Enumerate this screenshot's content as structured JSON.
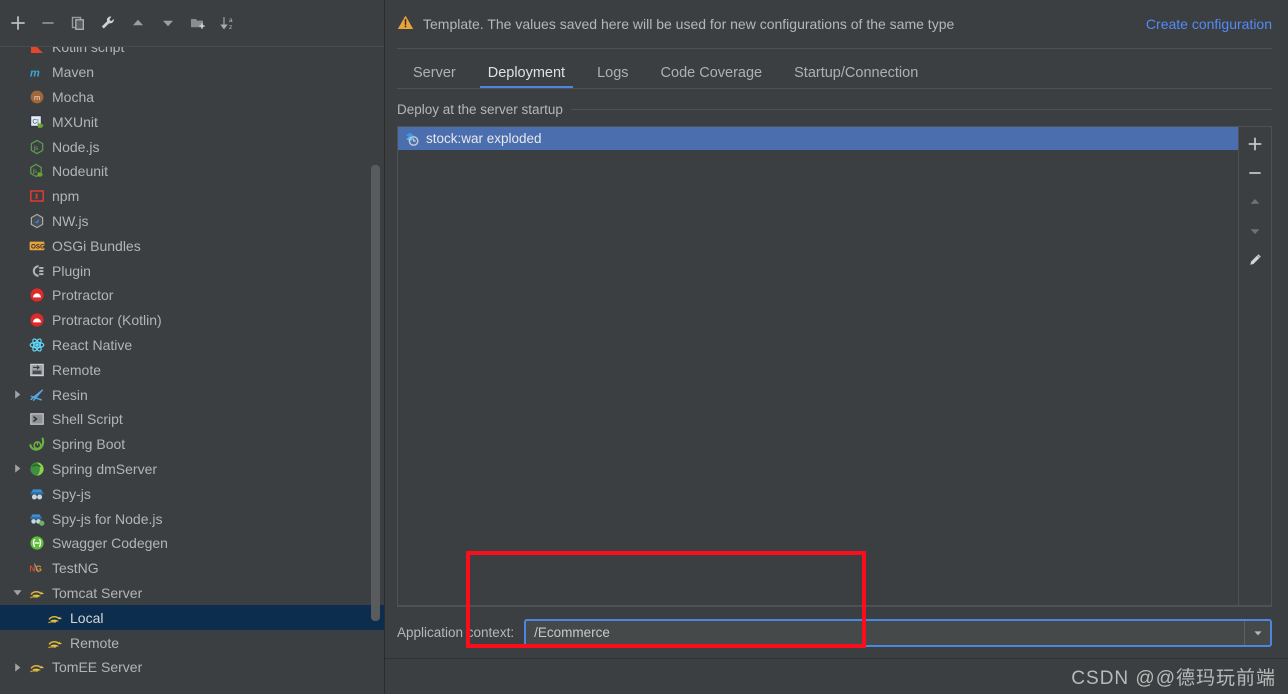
{
  "window": {
    "watermark": "CSDN @@德玛玩前端"
  },
  "toolbar": {
    "buttons": [
      {
        "name": "add",
        "icon": "plus-icon",
        "label": "Add New Configuration"
      },
      {
        "name": "remove",
        "icon": "minus-icon",
        "label": "Remove Configuration"
      },
      {
        "name": "copy",
        "icon": "copy-icon",
        "label": "Copy Configuration"
      },
      {
        "name": "edit-templates",
        "icon": "wrench-icon",
        "label": "Edit Templates"
      },
      {
        "name": "move-up",
        "icon": "arrow-up-icon",
        "label": "Move Up"
      },
      {
        "name": "move-down",
        "icon": "arrow-down-icon",
        "label": "Move Down"
      },
      {
        "name": "new-folder",
        "icon": "folder-add-icon",
        "label": "Create New Folder"
      },
      {
        "name": "sort",
        "icon": "sort-alpha-icon",
        "label": "Sort Configurations"
      }
    ]
  },
  "sidebar": {
    "items": [
      {
        "label": "Kotlin script",
        "icon": "kotlin-icon",
        "indent": 1,
        "twisty": "none",
        "selected": false
      },
      {
        "label": "Maven",
        "icon": "maven-icon",
        "indent": 1,
        "twisty": "none",
        "selected": false
      },
      {
        "label": "Mocha",
        "icon": "mocha-icon",
        "indent": 1,
        "twisty": "none",
        "selected": false
      },
      {
        "label": "MXUnit",
        "icon": "mxunit-icon",
        "indent": 1,
        "twisty": "none",
        "selected": false
      },
      {
        "label": "Node.js",
        "icon": "nodejs-icon",
        "indent": 1,
        "twisty": "none",
        "selected": false
      },
      {
        "label": "Nodeunit",
        "icon": "nodeunit-icon",
        "indent": 1,
        "twisty": "none",
        "selected": false
      },
      {
        "label": "npm",
        "icon": "npm-icon",
        "indent": 1,
        "twisty": "none",
        "selected": false
      },
      {
        "label": "NW.js",
        "icon": "nwjs-icon",
        "indent": 1,
        "twisty": "none",
        "selected": false
      },
      {
        "label": "OSGi Bundles",
        "icon": "osgi-icon",
        "indent": 1,
        "twisty": "none",
        "selected": false
      },
      {
        "label": "Plugin",
        "icon": "plugin-icon",
        "indent": 1,
        "twisty": "none",
        "selected": false
      },
      {
        "label": "Protractor",
        "icon": "protractor-icon",
        "indent": 1,
        "twisty": "none",
        "selected": false
      },
      {
        "label": "Protractor (Kotlin)",
        "icon": "protractor-icon",
        "indent": 1,
        "twisty": "none",
        "selected": false
      },
      {
        "label": "React Native",
        "icon": "react-native-icon",
        "indent": 1,
        "twisty": "none",
        "selected": false
      },
      {
        "label": "Remote",
        "icon": "remote-icon",
        "indent": 1,
        "twisty": "none",
        "selected": false
      },
      {
        "label": "Resin",
        "icon": "resin-icon",
        "indent": 1,
        "twisty": "collapsed",
        "selected": false
      },
      {
        "label": "Shell Script",
        "icon": "shell-script-icon",
        "indent": 1,
        "twisty": "none",
        "selected": false
      },
      {
        "label": "Spring Boot",
        "icon": "spring-boot-icon",
        "indent": 1,
        "twisty": "none",
        "selected": false
      },
      {
        "label": "Spring dmServer",
        "icon": "spring-dmserver-icon",
        "indent": 1,
        "twisty": "collapsed",
        "selected": false
      },
      {
        "label": "Spy-js",
        "icon": "spyjs-icon",
        "indent": 1,
        "twisty": "none",
        "selected": false
      },
      {
        "label": "Spy-js for Node.js",
        "icon": "spyjs-node-icon",
        "indent": 1,
        "twisty": "none",
        "selected": false
      },
      {
        "label": "Swagger Codegen",
        "icon": "swagger-icon",
        "indent": 1,
        "twisty": "none",
        "selected": false
      },
      {
        "label": "TestNG",
        "icon": "testng-icon",
        "indent": 1,
        "twisty": "none",
        "selected": false
      },
      {
        "label": "Tomcat Server",
        "icon": "tomcat-icon",
        "indent": 1,
        "twisty": "expanded",
        "selected": false
      },
      {
        "label": "Local",
        "icon": "tomcat-icon",
        "indent": 2,
        "twisty": "none",
        "selected": true
      },
      {
        "label": "Remote",
        "icon": "tomcat-icon",
        "indent": 2,
        "twisty": "none",
        "selected": false
      },
      {
        "label": "TomEE Server",
        "icon": "tomcat-icon",
        "indent": 1,
        "twisty": "collapsed",
        "selected": false
      }
    ]
  },
  "banner": {
    "icon": "warning-icon",
    "message": "Template. The values saved here will be used for new configurations of the same type",
    "action_label": "Create configuration"
  },
  "tabs": {
    "items": [
      {
        "label": "Server",
        "active": false
      },
      {
        "label": "Deployment",
        "active": true
      },
      {
        "label": "Logs",
        "active": false
      },
      {
        "label": "Code Coverage",
        "active": false
      },
      {
        "label": "Startup/Connection",
        "active": false
      }
    ]
  },
  "deployment": {
    "group_title": "Deploy at the server startup",
    "artifacts": [
      {
        "label": "stock:war exploded",
        "icon": "artifact-icon",
        "selected": true
      }
    ],
    "side_buttons": [
      {
        "name": "add-artifact",
        "icon": "plus-icon",
        "enabled": true
      },
      {
        "name": "remove-artifact",
        "icon": "minus-icon",
        "enabled": true
      },
      {
        "name": "move-artifact-up",
        "icon": "arrow-up-icon",
        "enabled": false
      },
      {
        "name": "move-artifact-down",
        "icon": "arrow-down-icon",
        "enabled": false
      },
      {
        "name": "edit-artifact",
        "icon": "pencil-icon",
        "enabled": true
      }
    ],
    "application_context": {
      "label": "Application context:",
      "value": "/Ecommerce",
      "placeholder": "",
      "dropdown_icon": "chevron-down-icon"
    }
  },
  "colors": {
    "panel_bg": "#3c3f41",
    "selection_blue": "#4b6eaf",
    "tree_selection": "#0d2d4e",
    "link_blue": "#548af7",
    "tab_underline": "#4a88e0",
    "annotation_red": "#fc0d1b",
    "warning_amber": "#e8a33d"
  }
}
